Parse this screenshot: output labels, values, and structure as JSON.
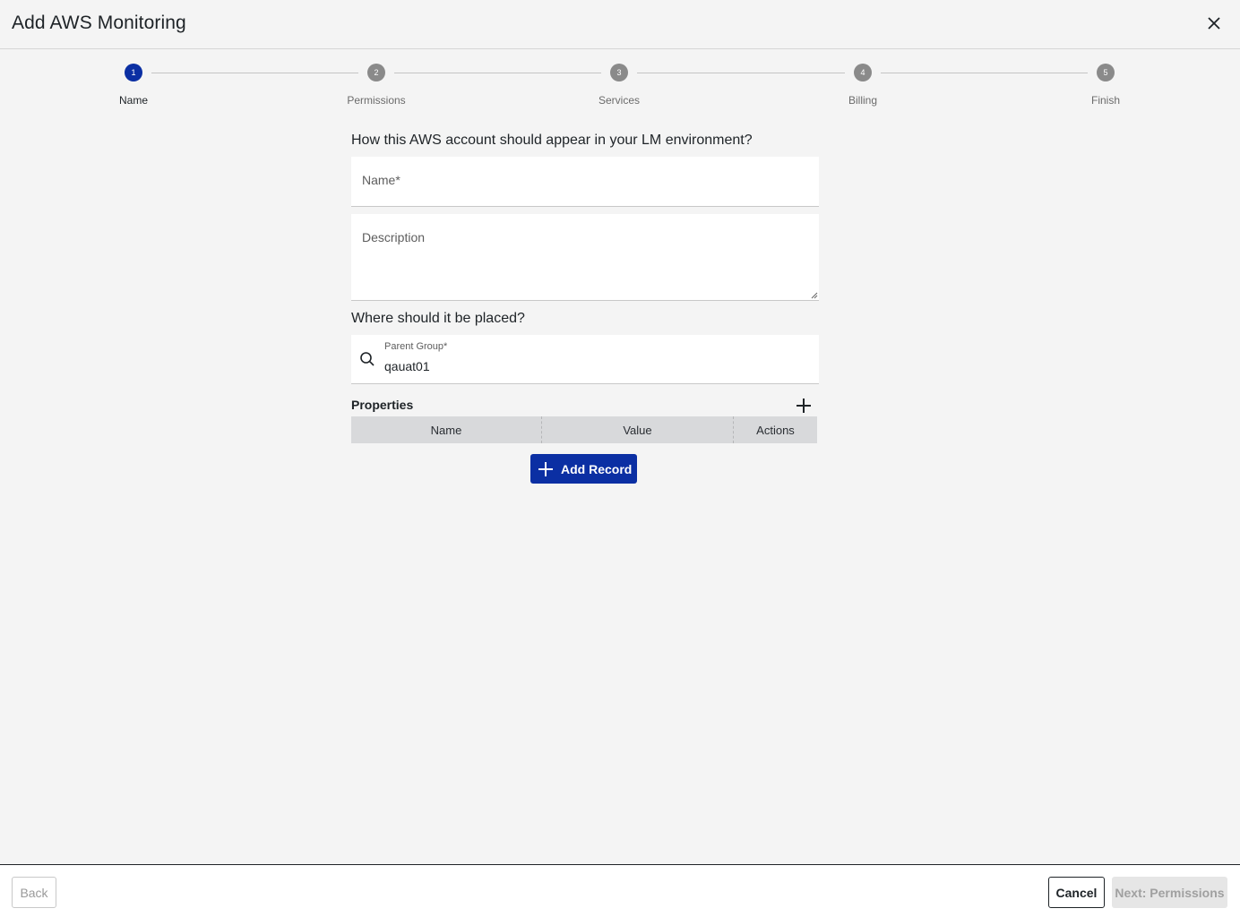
{
  "header": {
    "title": "Add AWS Monitoring",
    "close_icon": "close-icon"
  },
  "stepper": {
    "current_step": 1,
    "steps": [
      {
        "number": "1",
        "label": "Name",
        "active": true
      },
      {
        "number": "2",
        "label": "Permissions",
        "active": false
      },
      {
        "number": "3",
        "label": "Services",
        "active": false
      },
      {
        "number": "4",
        "label": "Billing",
        "active": false
      },
      {
        "number": "5",
        "label": "Finish",
        "active": false
      }
    ]
  },
  "form": {
    "appear_heading": "How this AWS account should appear in your LM environment?",
    "name_field": {
      "label": "Name*",
      "value": ""
    },
    "description_field": {
      "label": "Description",
      "value": ""
    },
    "placement_heading": "Where should it be placed?",
    "parent_group": {
      "label": "Parent Group*",
      "value": "qauat01",
      "icon": "search-icon"
    }
  },
  "properties": {
    "title": "Properties",
    "add_icon": "plus-icon",
    "columns": [
      "Name",
      "Value",
      "Actions"
    ],
    "rows": [],
    "add_record_label": "Add Record"
  },
  "footer": {
    "back_label": "Back",
    "cancel_label": "Cancel",
    "next_label": "Next: Permissions"
  },
  "colors": {
    "primary": "#0b2fa3",
    "background": "#f4f4f4",
    "step_inactive": "#8a8a8a",
    "table_header": "#d8d9db"
  }
}
